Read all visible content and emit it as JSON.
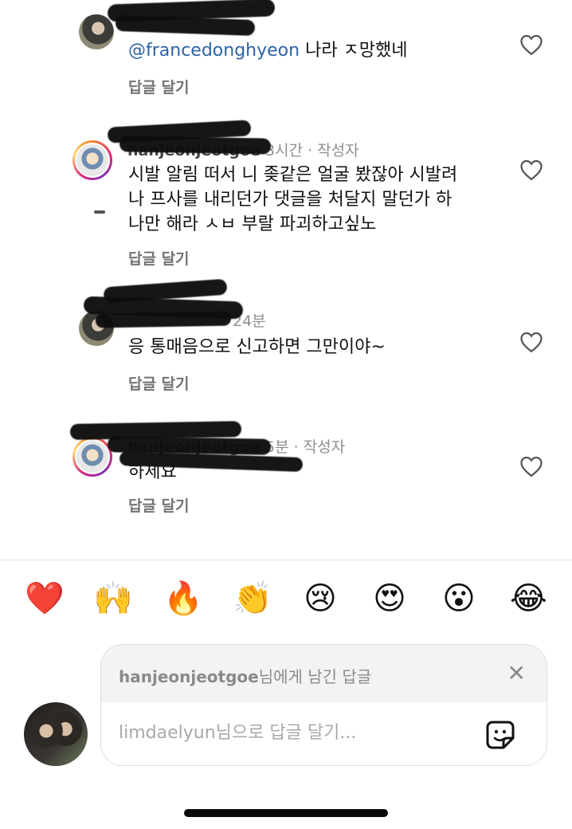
{
  "comments": [
    {
      "id": "c1",
      "mention": "@francedonghyeon",
      "text": " 나라 ㅈ망했네",
      "reply_label": "답글 달기"
    },
    {
      "id": "c2",
      "user": "hanjeonjeotgoe",
      "time": "3시간",
      "author_tag": "작성자",
      "lines": [
        "시발 알림 떠서 니 좆같은 얼굴 봤잖아 시발려",
        "나 프사를 내리던가 댓글을 처달지 말던가 하",
        "나만 해라 ㅅㅂ 부랄 파괴하고싶노"
      ],
      "reply_label": "답글 달기"
    },
    {
      "id": "c3",
      "time": "24분",
      "text": "응 통매음으로 신고하면 그만이야~",
      "reply_label": "답글 달기"
    },
    {
      "id": "c4",
      "user": "hanjeonjeotgoe",
      "time": "5분",
      "author_tag": "작성자",
      "text": "하세요",
      "reply_label": "답글 달기"
    }
  ],
  "reactions": [
    "❤️",
    "🙌",
    "🔥",
    "👏",
    "😢",
    "😍",
    "😮",
    "😂"
  ],
  "composer": {
    "replying_to_user": "hanjeonjeotgoe",
    "replying_to_suffix": "님에게 남긴 답글",
    "placeholder": "limdaelyun님으로 답글 달기..."
  },
  "colors": {
    "mention": "#2c63a6",
    "muted": "#8e8e8e",
    "ring": "#dd2a7b"
  },
  "icons": [
    "heart-outline-icon",
    "close-icon",
    "sticker-icon"
  ]
}
